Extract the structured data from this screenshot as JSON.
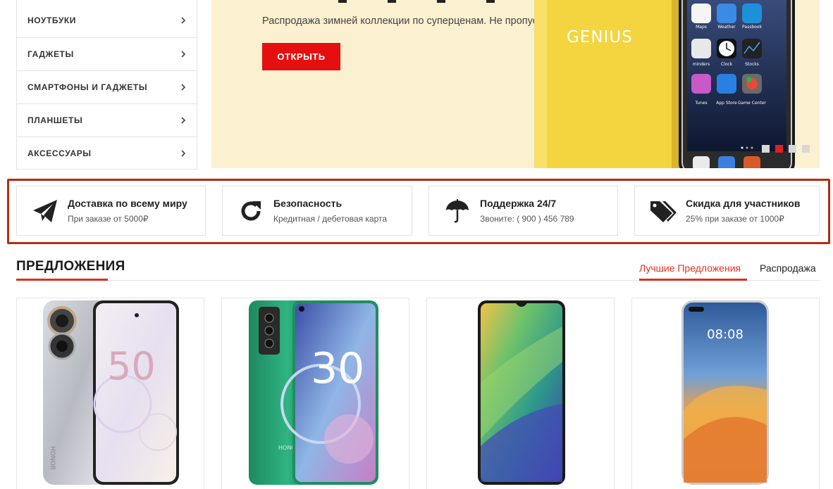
{
  "sidebar": {
    "items": [
      {
        "label": "НОУТБУКИ"
      },
      {
        "label": "ГАДЖЕТЫ"
      },
      {
        "label": "СМАРТФОНЫ И ГАДЖЕТЫ"
      },
      {
        "label": "ПЛАНШЕТЫ"
      },
      {
        "label": "АКСЕССУАРЫ"
      }
    ]
  },
  "banner": {
    "subtitle": "Распродажа зимней коллекции по суперценам. Не пропустите!",
    "button_label": "ОТКРЫТЬ",
    "case_brand": "GENIUS",
    "phone_apps": [
      "Maps",
      "Weather",
      "Passbook",
      "minders",
      "Clock",
      "Stocks",
      "Tunes",
      "App Store",
      "Game Center"
    ],
    "slides_count": 4,
    "active_slide": 2
  },
  "features": [
    {
      "title": "Доставка по всему миру",
      "subtitle": "При заказе от 5000₽",
      "icon": "paper-plane-icon"
    },
    {
      "title": "Безопасность",
      "subtitle": "Кредитная / дебетовая карта",
      "icon": "refresh-icon"
    },
    {
      "title": "Поддержка 24/7",
      "subtitle": "Звоните: ( 900 ) 456 789",
      "icon": "umbrella-icon"
    },
    {
      "title": "Скидка для участников",
      "subtitle": "25% при заказе от 1000₽",
      "icon": "tags-icon"
    }
  ],
  "offers": {
    "title": "ПРЕДЛОЖЕНИЯ",
    "tabs": [
      {
        "label": "Лучшие Предложения",
        "active": true
      },
      {
        "label": "Распродажа",
        "active": false
      }
    ]
  },
  "products": [
    {
      "screen_text": "50",
      "side_text": "HONOR"
    },
    {
      "screen_text": "30",
      "side_text": "HONOR"
    },
    {
      "screen_text": ""
    },
    {
      "screen_text": "08:08"
    }
  ],
  "colors": {
    "accent": "#e60f0f",
    "tab_active": "#e0311f",
    "banner_bg": "#fbf0cf",
    "highlight_frame": "#b32d0f"
  }
}
